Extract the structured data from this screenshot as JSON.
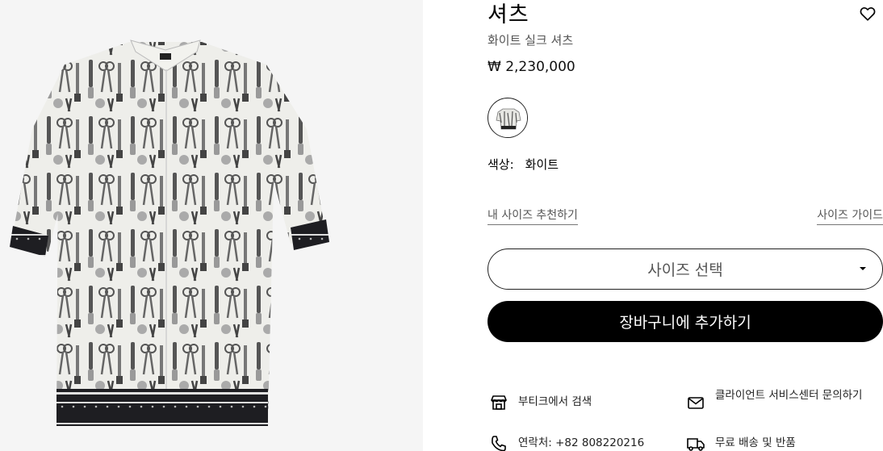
{
  "product": {
    "title": "셔츠",
    "subtitle": "화이트 실크 셔츠",
    "price": "₩ 2,230,000",
    "color_label": "색상:",
    "color_value": "화이트"
  },
  "links": {
    "size_recommend": "내 사이즈 추천하기",
    "size_guide": "사이즈 가이드"
  },
  "size_select": {
    "label": "사이즈 선택"
  },
  "add_to_cart": {
    "label": "장바구니에 추가하기"
  },
  "services": [
    {
      "label": "부티크에서 검색",
      "icon": "store-icon"
    },
    {
      "label": "클라이언트 서비스센터 문의하기",
      "icon": "mail-icon"
    },
    {
      "label": "연락처: +82 808220216",
      "icon": "phone-icon"
    },
    {
      "label": "무료 배송 및 반품",
      "icon": "delivery-truck-icon"
    }
  ],
  "colors": {
    "accent": "#000000",
    "muted_text": "#555555",
    "background": "#ffffff"
  }
}
